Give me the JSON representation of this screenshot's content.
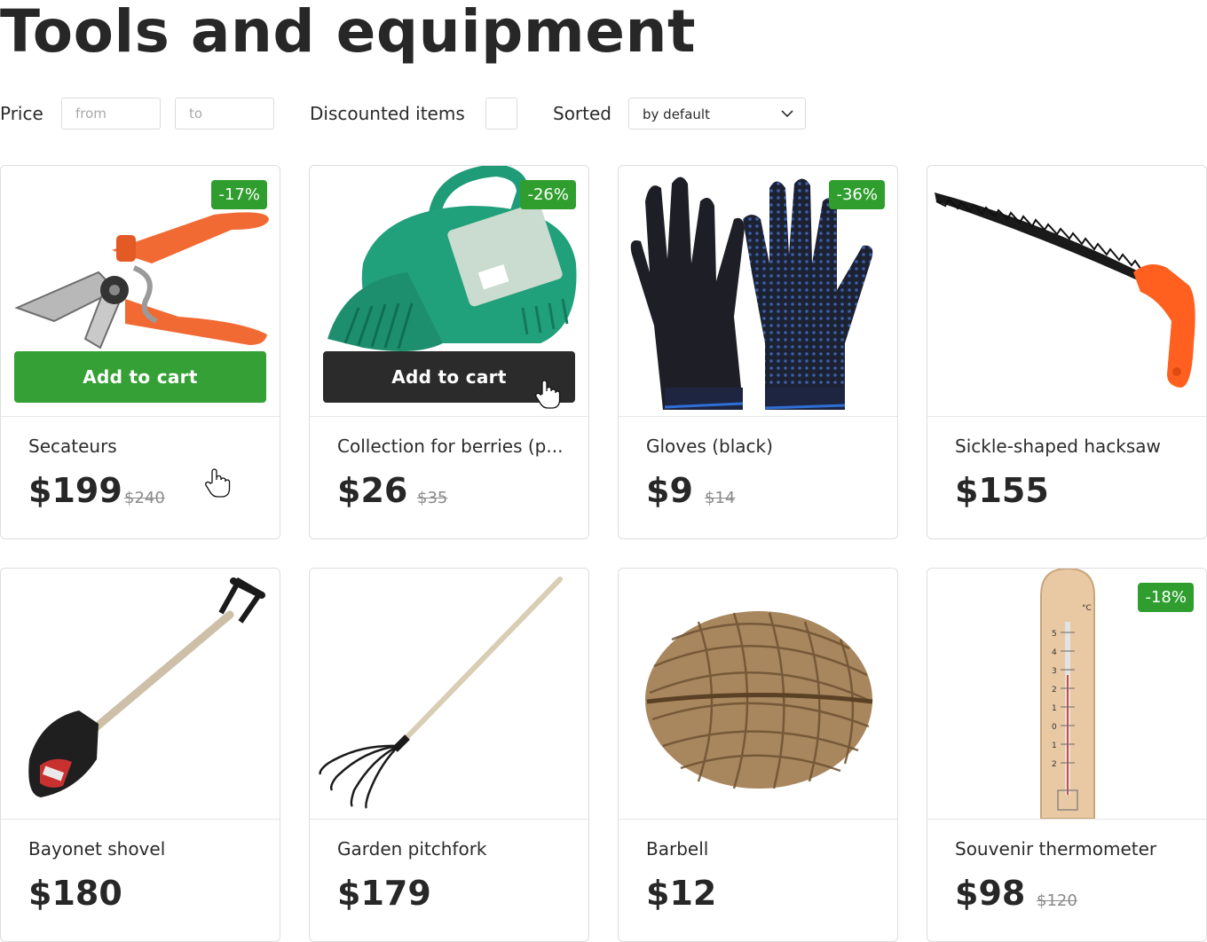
{
  "page": {
    "title": "Tools and equipment"
  },
  "filters": {
    "price_label": "Price",
    "price_from_placeholder": "from",
    "price_to_placeholder": "to",
    "discounted_label": "Discounted items",
    "discounted_checked": false,
    "sorted_label": "Sorted",
    "sort_value": "by default"
  },
  "products": [
    {
      "name": "Secateurs",
      "price": "$199",
      "old_price": "$240",
      "badge": "-17%",
      "add_to_cart": "Add to cart",
      "icon": "secateurs-image"
    },
    {
      "name": "Collection for berries (p...",
      "price": "$26",
      "old_price": "$35",
      "badge": "-26%",
      "add_to_cart": "Add to cart",
      "icon": "berry-picker-image"
    },
    {
      "name": "Gloves (black)",
      "price": "$9",
      "old_price": "$14",
      "badge": "-36%",
      "icon": "gloves-image"
    },
    {
      "name": "Sickle-shaped hacksaw",
      "price": "$155",
      "icon": "hacksaw-image"
    },
    {
      "name": "Bayonet shovel",
      "price": "$180",
      "icon": "shovel-image"
    },
    {
      "name": "Garden pitchfork",
      "price": "$179",
      "icon": "pitchfork-image"
    },
    {
      "name": "Barbell",
      "price": "$12",
      "icon": "twine-ball-image"
    },
    {
      "name": "Souvenir thermometer",
      "price": "$98",
      "old_price": "$120",
      "badge": "-18%",
      "icon": "thermometer-image",
      "thermo_unit": "°C",
      "thermo_scale": [
        "5",
        "4",
        "3",
        "2",
        "1",
        "0",
        "1",
        "2"
      ]
    }
  ],
  "colors": {
    "badge_green": "#2f9e2f",
    "button_green": "#35a035",
    "button_dark": "#2b2b2b",
    "text": "#2b2b2b"
  }
}
